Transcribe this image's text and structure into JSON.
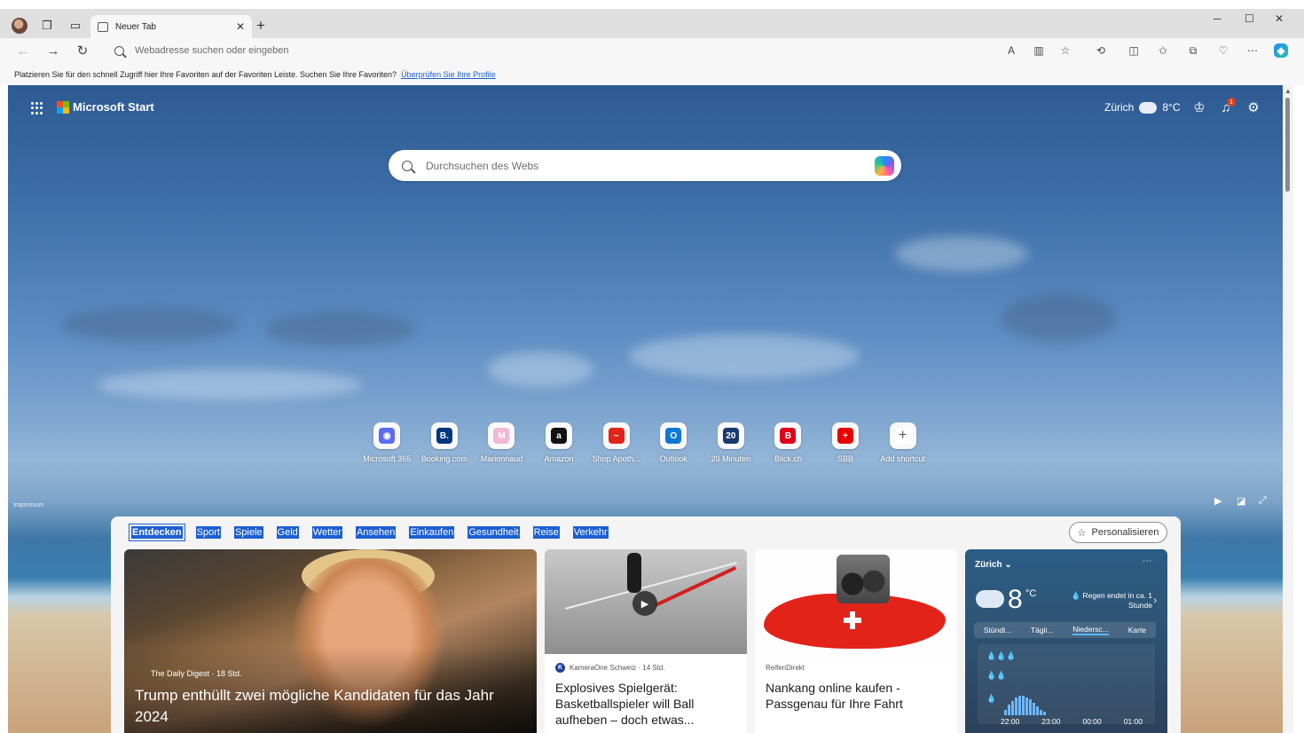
{
  "browser": {
    "tab_title": "Neuer Tab",
    "address_placeholder": "Webadresse suchen oder eingeben",
    "favbar_text": "Platzieren Sie für den schnell Zugriff hier Ihre Favoriten auf der Favoriten Leiste. Suchen Sie Ihre Favoriten?",
    "favbar_link": "Überprüfen Sie Ihre Profile"
  },
  "header": {
    "title": "Microsoft Start",
    "city": "Zürich",
    "temp": "8°C",
    "notif_count": "1"
  },
  "search": {
    "placeholder": "Durchsuchen des Webs"
  },
  "shortcuts": [
    {
      "label": "Microsoft 365",
      "glyph": "◉",
      "color": "#5b6cf0"
    },
    {
      "label": "Booking.com",
      "glyph": "B.",
      "color": "#003580"
    },
    {
      "label": "Marionnaud",
      "glyph": "M",
      "color": "#f0b7d6"
    },
    {
      "label": "Amazon",
      "glyph": "a",
      "color": "#111111"
    },
    {
      "label": "Shop Apoth...",
      "glyph": "~",
      "color": "#e2231a"
    },
    {
      "label": "Outlook",
      "glyph": "O",
      "color": "#0f78d4"
    },
    {
      "label": "20 Minuten",
      "glyph": "20",
      "color": "#1a3a6e"
    },
    {
      "label": "Blick.ch",
      "glyph": "B",
      "color": "#e2001a"
    },
    {
      "label": "SBB",
      "glyph": "+",
      "color": "#eb0000"
    },
    {
      "label": "Add shortcut",
      "glyph": "+",
      "color": "#ffffff"
    }
  ],
  "impressum": "Impressum",
  "feed": {
    "tabs": [
      "Entdecken",
      "Sport",
      "Spiele",
      "Geld",
      "Wetter",
      "Ansehen",
      "Einkaufen",
      "Gesundheit",
      "Reise",
      "Verkehr"
    ],
    "personalize": "Personalisieren",
    "lead": {
      "source": "The Daily Digest · 18 Std.",
      "title": "Trump enthüllt zwei mögliche Kandidaten für das Jahr 2024"
    },
    "card2": {
      "source": "KameraOne Schweiz · 14 Std.",
      "title": "Explosives Spielgerät: Basketballspieler will Ball aufheben – doch etwas..."
    },
    "card3": {
      "source": "ReifenDirekt",
      "title": "Nankang online kaufen - Passgenau für Ihre Fahrt"
    },
    "weather": {
      "city": "Zürich",
      "temp": "8",
      "unit": "°C",
      "note": "Regen endet in ca. 1 Stunde",
      "tabs": [
        "Stündl...",
        "Tägli...",
        "Niedersc...",
        "Karte"
      ],
      "times": [
        "22:00",
        "23:00",
        "00:00",
        "01:00"
      ]
    }
  },
  "colors": {
    "accent": "#1d5fd3",
    "link": "#1a5fd0"
  }
}
